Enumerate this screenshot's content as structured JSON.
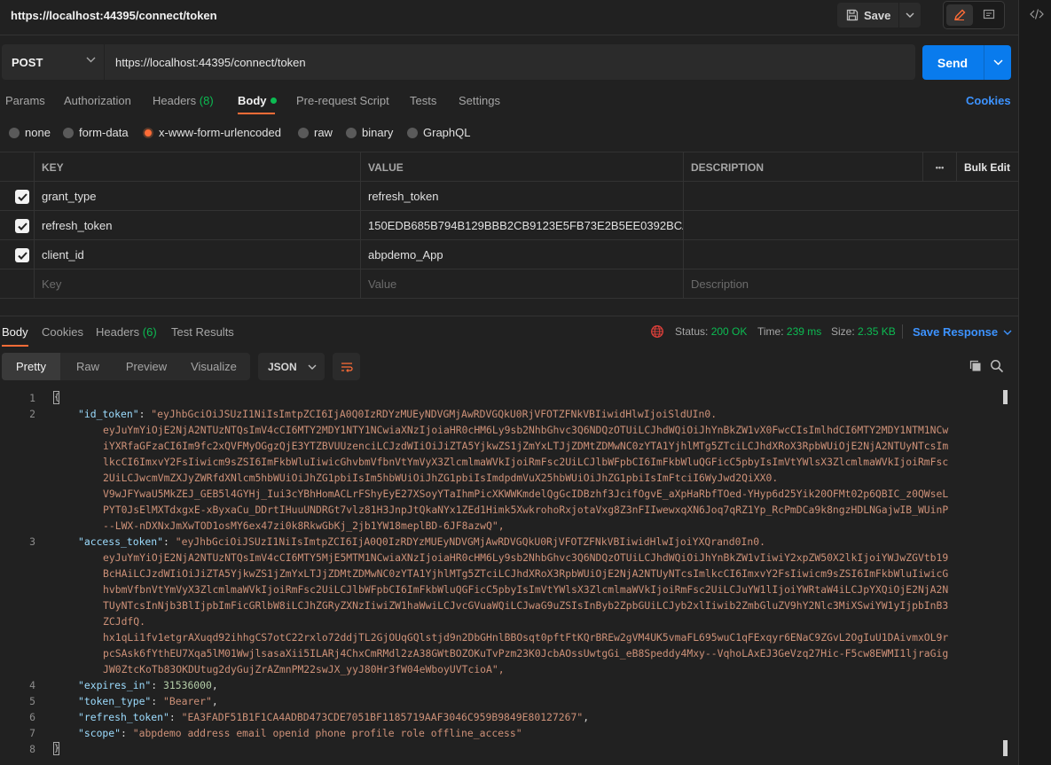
{
  "header": {
    "title": "https://localhost:44395/connect/token",
    "save_label": "Save"
  },
  "request": {
    "method": "POST",
    "url": "https://localhost:44395/connect/token",
    "send_label": "Send"
  },
  "tabs": {
    "params": "Params",
    "authorization": "Authorization",
    "headers": "Headers",
    "headers_count": "(8)",
    "body": "Body",
    "pre_request": "Pre-request Script",
    "tests": "Tests",
    "settings": "Settings",
    "cookies": "Cookies"
  },
  "body_types": {
    "none": "none",
    "form_data": "form-data",
    "urlencoded": "x-www-form-urlencoded",
    "raw": "raw",
    "binary": "binary",
    "graphql": "GraphQL",
    "selected": "x-www-form-urlencoded"
  },
  "params_table": {
    "headers": {
      "key": "KEY",
      "value": "VALUE",
      "description": "DESCRIPTION",
      "more": "•••",
      "bulk_edit": "Bulk Edit"
    },
    "rows": [
      {
        "key": "grant_type",
        "value": "refresh_token",
        "checked": true
      },
      {
        "key": "refresh_token",
        "value": "150EDB685B794B129BBB2CB9123E5FB73E2B5EE0392BCA...",
        "checked": true
      },
      {
        "key": "client_id",
        "value": "abpdemo_App",
        "checked": true
      }
    ],
    "placeholders": {
      "key": "Key",
      "value": "Value",
      "description": "Description"
    }
  },
  "response": {
    "tabs": {
      "body": "Body",
      "cookies": "Cookies",
      "headers": "Headers",
      "headers_count": "(6)",
      "test_results": "Test Results"
    },
    "status_label": "Status:",
    "status": "200 OK",
    "time_label": "Time:",
    "time": "239 ms",
    "size_label": "Size:",
    "size": "2.35 KB",
    "save_response": "Save Response",
    "formats": {
      "pretty": "Pretty",
      "raw": "Raw",
      "preview": "Preview",
      "visualize": "Visualize"
    },
    "lang": "JSON"
  },
  "json_body": {
    "line_numbers": [
      "1",
      "2",
      "3",
      "4",
      "5",
      "6",
      "7",
      "8"
    ],
    "id_token_key": "\"id_token\"",
    "id_token_lines": [
      "\"eyJhbGciOiJSUzI1NiIsImtpZCI6IjA0Q0IzRDYzMUEyNDVGMjAwRDVGQkU0RjVFOTZFNkVBIiwidHlwIjoiSldUIn0.",
      "eyJuYmYiOjE2NjA2NTUzNTQsImV4cCI6MTY2MDY1NTY1NCwiaXNzIjoiaHR0cHM6Ly9sb2NhbGhvc3Q6NDQzOTUiLCJhdWQiOiJhYnBkZW1vX0FwcCIsImlhdCI6MTY2MDY1NTM1NCw",
      "iYXRfaGFzaCI6Im9fc2xQVFMyOGgzQjE3YTZBVUUzenciLCJzdWIiOiJiZTA5YjkwZS1jZmYxLTJjZDMtZDMwNC0zYTA1YjhlMTg5ZTciLCJhdXRoX3RpbWUiOjE2NjA2NTUyNTcsIm",
      "lkcCI6ImxvY2FsIiwicm9sZSI6ImFkbWluIiwicGhvbmVfbnVtYmVyX3ZlcmlmaWVkIjoiRmFsc2UiLCJlbWFpbCI6ImFkbWluQGFicC5pbyIsImVtYWlsX3ZlcmlmaWVkIjoiRmFsc",
      "2UiLCJwcmVmZXJyZWRfdXNlcm5hbWUiOiJhZG1pbiIsIm5hbWUiOiJhZG1pbiIsImdpdmVuX25hbWUiOiJhZG1pbiIsImFtciI6WyJwd2QiXX0.",
      "V9wJFYwaU5MkZEJ_GEB5l4GYHj_Iui3cYBhHomACLrFShyEyE27XSoyYTaIhmPicXKWWKmdelQgGcIDBzhf3JcifOgvE_aXpHaRbfTOed-YHyp6d25Yik20OFMt02p6QBIC_z0QWseL",
      "PYT0JsElMXTdxgxE-xByxaCu_DDrtIHuuUNDRGt7vlz81H3JnpJtQkaNYx1ZEd1Himk5XwkrohoRxjotaVxg8Z3nFIIwewxqXN6Joq7qRZ1Yp_RcPmDCa9k8ngzHDLNGajwIB_WUinP",
      "--LWX-nDXNxJmXwTOD1osMY6ex47zi0k8RkwGbKj_2jb1YW18meplBD-6JF8azwQ\","
    ],
    "access_token_key": "\"access_token\"",
    "access_token_lines": [
      "\"eyJhbGciOiJSUzI1NiIsImtpZCI6IjA0Q0IzRDYzMUEyNDVGMjAwRDVGQkU0RjVFOTZFNkVBIiwidHlwIjoiYXQrand0In0.",
      "eyJuYmYiOjE2NjA2NTUzNTQsImV4cCI6MTY5MjE5MTM1NCwiaXNzIjoiaHR0cHM6Ly9sb2NhbGhvc3Q6NDQzOTUiLCJhdWQiOiJhYnBkZW1vIiwiY2xpZW50X2lkIjoiYWJwZGVtb19",
      "BcHAiLCJzdWIiOiJiZTA5YjkwZS1jZmYxLTJjZDMtZDMwNC0zYTA1YjhlMTg5ZTciLCJhdXRoX3RpbWUiOjE2NjA2NTUyNTcsImlkcCI6ImxvY2FsIiwicm9sZSI6ImFkbWluIiwicG",
      "hvbmVfbnVtYmVyX3ZlcmlmaWVkIjoiRmFsc2UiLCJlbWFpbCI6ImFkbWluQGFicC5pbyIsImVtYWlsX3ZlcmlmaWVkIjoiRmFsc2UiLCJuYW1lIjoiYWRtaW4iLCJpYXQiOjE2NjA2N",
      "TUyNTcsInNjb3BlIjpbImFicGRlbW8iLCJhZGRyZXNzIiwiZW1haWwiLCJvcGVuaWQiLCJwaG9uZSIsInByb2ZpbGUiLCJyb2xlIiwib2ZmbGluZV9hY2Nlc3MiXSwiYW1yIjpbInB3",
      "ZCJdfQ.",
      "hx1qLi1fv1etgrAXuqd92ihhgCS7otC22rxlo72ddjTL2GjOUqGQlstjd9n2DbGHnlBBOsqt0pftFtKQrBREw2gVM4UK5vmaFL695wuC1qFExqyr6ENaC9ZGvL2OgIuU1DAivmxOL9r",
      "pcSAsk6fYthEU7Xqa5lM01WwjlsasaXii5ILARj4ChxCmRMdl2zA38GWtBOZOKuTvPzm23K0JcbAOssUwtgGi_eB8Speddy4Mxy--VqhoLAxEJ3GeVzq27Hic-F5cw8EWMI1ljraGig",
      "JW0ZtcKoTb83OKDUtug2dyGujZrAZmnPM22swJX_yyJ80Hr3fW04eWboyUVTcioA\","
    ],
    "expires_in_key": "\"expires_in\"",
    "expires_in_value": "31536000",
    "token_type_key": "\"token_type\"",
    "token_type_value": "\"Bearer\"",
    "refresh_token_key": "\"refresh_token\"",
    "refresh_token_value": "\"EA3FADF51B1F1CA4ADBD473CDE7051BF1185719AAF3046C959B9849E80127267\"",
    "scope_key": "\"scope\"",
    "scope_value": "\"abpdemo address email openid phone profile role offline_access\""
  },
  "colors": {
    "accent_orange": "#ff6c37",
    "send_blue": "#097bed",
    "link_blue": "#3d93ff",
    "status_green": "#0cbb52"
  }
}
